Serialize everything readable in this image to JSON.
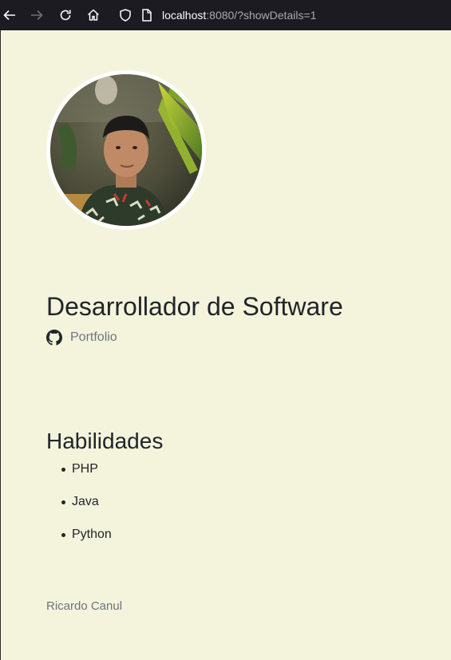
{
  "browser": {
    "url_host": "localhost",
    "url_rest": ":8080/?showDetails=1"
  },
  "profile": {
    "avatar_alt": "Profile photo"
  },
  "header": {
    "job_title": "Desarrollador de Software",
    "portfolio_label": "Portfolio"
  },
  "skills": {
    "heading": "Habilidades",
    "items": [
      "PHP",
      "Java",
      "Python"
    ]
  },
  "footer": {
    "name": "Ricardo Canul"
  },
  "colors": {
    "page_background": "#f4f4dc",
    "browser_bar": "#1c1b22",
    "muted_text": "#6c757d",
    "main_text": "#212529"
  }
}
